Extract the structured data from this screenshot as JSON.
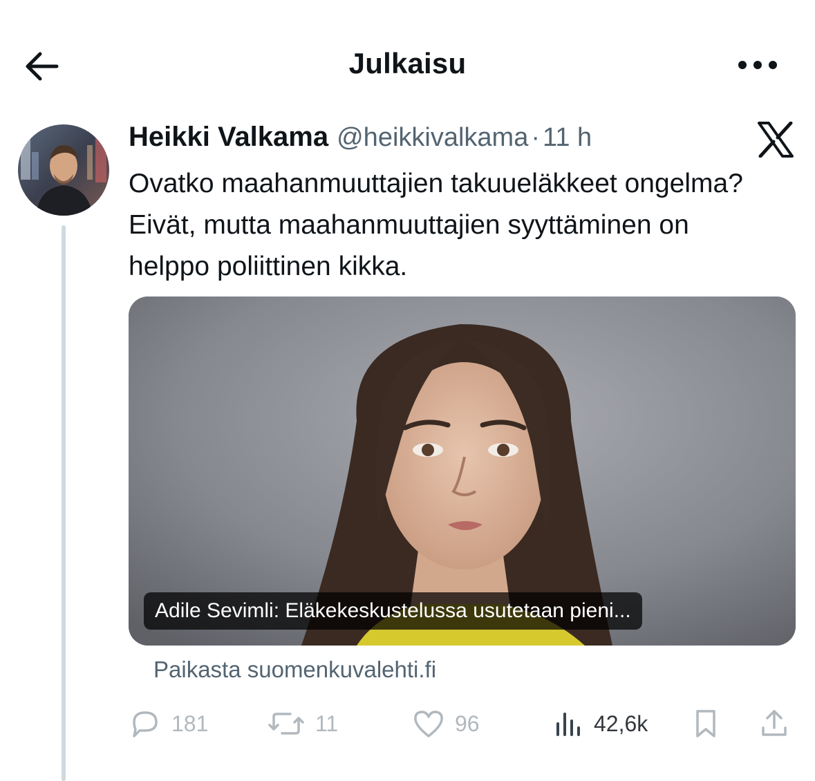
{
  "header": {
    "title": "Julkaisu",
    "back_icon": "arrow-left-icon",
    "more_icon": "more-horizontal-icon"
  },
  "post": {
    "author_name": "Heikki Valkama",
    "author_handle": "@heikkivalkama",
    "separator": "·",
    "time": "11 h",
    "text": "Ovatko maahanmuuttajien takuueläkkeet ongelma? Eivät, mutta maahanmuuttajien syyttäminen on helppo poliittinen kikka.",
    "platform_icon": "x-logo-icon"
  },
  "link_card": {
    "caption": "Adile Sevimli: Eläkekeskustelussa usutetaan pieni...",
    "source": "Paikasta suomenkuvalehti.fi"
  },
  "actions": {
    "replies": "181",
    "reposts": "11",
    "likes": "96",
    "views": "42,6k"
  },
  "colors": {
    "text_primary": "#0f1419",
    "text_secondary": "#536471",
    "thread_line": "#cfd9de",
    "background": "#ffffff"
  }
}
